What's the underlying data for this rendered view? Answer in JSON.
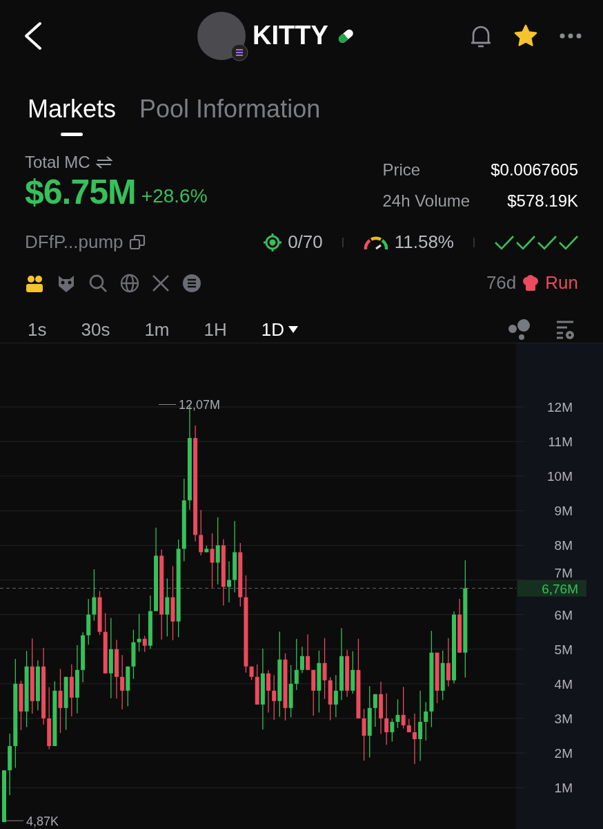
{
  "header": {
    "title": "KITTY",
    "favorited": true
  },
  "tabs": [
    {
      "label": "Markets",
      "selected": true
    },
    {
      "label": "Pool Information",
      "selected": false
    }
  ],
  "market_cap": {
    "label": "Total MC",
    "value": "$6.75M",
    "change": "+28.6%"
  },
  "stats": [
    {
      "label": "Price",
      "value": "$0.0067605"
    },
    {
      "label": "24h Volume",
      "value": "$578.19K"
    }
  ],
  "token": {
    "address": "DFfP...pump",
    "snipers": "0/70",
    "gauge": "11.58%",
    "age": "76d",
    "status": "Run"
  },
  "timeframes": [
    {
      "label": "1s",
      "selected": false
    },
    {
      "label": "30s",
      "selected": false
    },
    {
      "label": "1m",
      "selected": false
    },
    {
      "label": "1H",
      "selected": false
    },
    {
      "label": "1D",
      "selected": true
    }
  ],
  "chart": {
    "y_labels": [
      "12M",
      "11M",
      "10M",
      "9M",
      "8M",
      "7M",
      "6M",
      "5M",
      "4M",
      "3M",
      "2M",
      "1M"
    ],
    "high_label": "12,07M",
    "low_label": "4,87K",
    "current_label": "6,76M"
  }
}
